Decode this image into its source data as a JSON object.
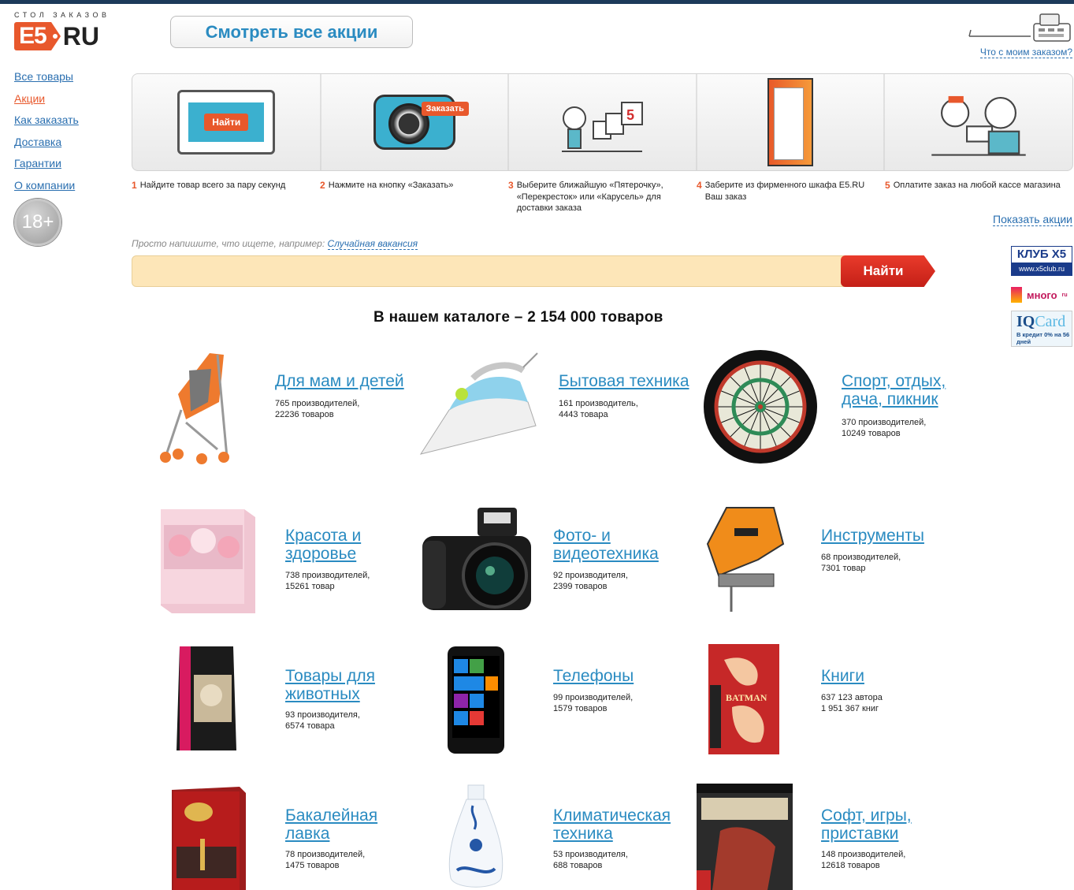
{
  "logo": {
    "tagline": "СТОЛ ЗАКАЗОВ",
    "mark": "E5",
    "ru": "RU"
  },
  "sidebar": {
    "items": [
      {
        "label": "Все товары"
      },
      {
        "label": "Акции"
      },
      {
        "label": "Как заказать"
      },
      {
        "label": "Доставка"
      },
      {
        "label": "Гарантии"
      },
      {
        "label": "О компании"
      }
    ],
    "age_badge": "18+"
  },
  "header": {
    "promo_button": "Смотреть все акции",
    "order_status_link": "Что с моим заказом?",
    "register_icon": "cash-register-icon"
  },
  "steps": {
    "find_button": "Найти",
    "order_button": "Заказать",
    "items": [
      {
        "num": "1",
        "text": "Найдите товар всего за пару секунд"
      },
      {
        "num": "2",
        "text": "Нажмите на кнопку «Заказать»"
      },
      {
        "num": "3",
        "text": "Выберите ближайшую «Пятерочку», «Перекресток» или «Карусель» для доставки заказа"
      },
      {
        "num": "4",
        "text": "Заберите из фирменного шкафа E5.RU Ваш заказ"
      },
      {
        "num": "5",
        "text": "Оплатите заказ на любой кассе магазина"
      }
    ]
  },
  "show_promos_link": "Показать акции",
  "partners": {
    "x5_name": "КЛУБ X5",
    "x5_url": "www.x5club.ru",
    "mnogo": "много",
    "mnogo_suffix": "ru",
    "iq_a": "IQ",
    "iq_b": "Card",
    "iq_note": "В кредит 0% на 56 дней"
  },
  "search": {
    "hint_prefix": "Просто напишите, что ищете, например:",
    "hint_example": "Случайная вакансия",
    "value": "",
    "placeholder": "",
    "button": "Найти"
  },
  "catalog": {
    "title": "В нашем каталоге – 2 154 000 товаров",
    "categories": [
      {
        "name": "Для мам и детей",
        "meta": "765 производителей,\n22236 товаров",
        "icon": "stroller-icon"
      },
      {
        "name": "Бытовая техника",
        "meta": "161 производитель,\n4443 товара",
        "icon": "iron-icon"
      },
      {
        "name": "Спорт, отдых,\nдача, пикник",
        "meta": "370 производителей,\n10249 товаров",
        "icon": "darts-board-icon"
      },
      {
        "name": "Красота и\nздоровье",
        "meta": "738 производителей,\n15261 товар",
        "icon": "gift-box-icon"
      },
      {
        "name": "Фото- и\nвидеотехника",
        "meta": "92 производителя,\n2399 товаров",
        "icon": "camera-icon"
      },
      {
        "name": "Инструменты",
        "meta": "68 производителей,\n7301 товар",
        "icon": "jigsaw-icon"
      },
      {
        "name": "Товары для\nживотных",
        "meta": "93 производителя,\n6574 товара",
        "icon": "cat-food-icon"
      },
      {
        "name": "Телефоны",
        "meta": "99 производителей,\n1579 товаров",
        "icon": "smartphone-icon"
      },
      {
        "name": "Книги",
        "meta": "637 123 автора\n1 951 367 книг",
        "icon": "book-icon"
      },
      {
        "name": "Бакалейная\nлавка",
        "meta": "78 производителей,\n1475 товаров",
        "icon": "tea-box-icon"
      },
      {
        "name": "Климатическая\nтехника",
        "meta": "53 производителя,\n688 товаров",
        "icon": "humidifier-icon"
      },
      {
        "name": "Софт, игры,\nприставки",
        "meta": "148 производителей,\n12618 товаров",
        "icon": "game-box-icon"
      }
    ]
  },
  "colors": {
    "accent": "#e8582c",
    "link": "#2a6fb0",
    "category_link": "#2a8bc1",
    "search_bg": "#fde6b8",
    "search_btn": "#d8271c"
  }
}
